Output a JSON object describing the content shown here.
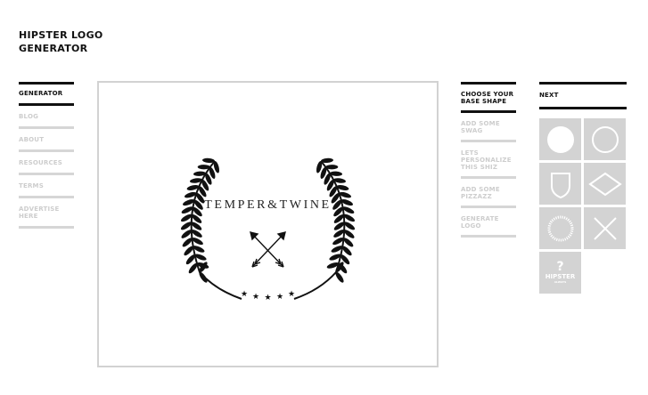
{
  "brand": {
    "line1": "HIPSTER LOGO",
    "line2": "GENERATOR"
  },
  "left_nav": {
    "title": "GENERATOR",
    "items": [
      "BLOG",
      "ABOUT",
      "RESOURCES",
      "TERMS",
      "ADVERTISE HERE"
    ]
  },
  "logo": {
    "text": "TEMPER&TWINE",
    "stars": 5
  },
  "steps": {
    "title": "CHOOSE YOUR BASE SHAPE",
    "items": [
      "ADD SOME SWAG",
      "LETS PERSONALIZE THIS SHIZ",
      "ADD SOME PIZZAZZ",
      "GENERATE LOGO"
    ]
  },
  "shapes": {
    "title": "NEXT",
    "tiles": [
      "filled-circle",
      "outline-circle",
      "shield",
      "diamond",
      "dotted-circle",
      "x-cross",
      "hipster-random"
    ],
    "random": {
      "symbol": "?",
      "word": "HIPSTER",
      "small": "ALWAYS"
    }
  }
}
